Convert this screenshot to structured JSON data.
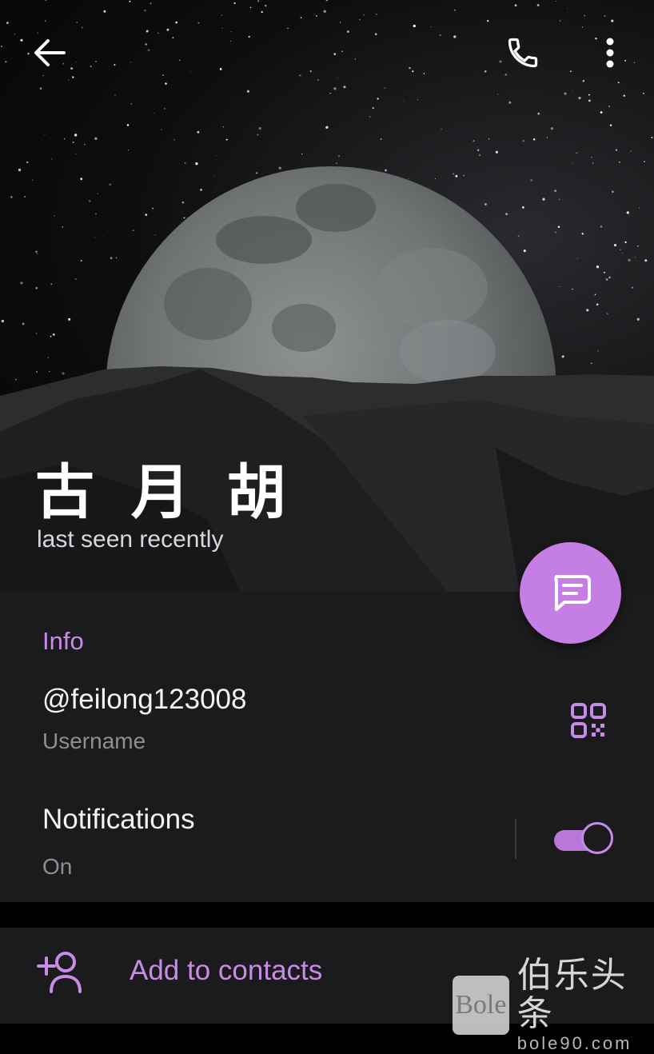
{
  "header": {
    "name": "古 月 胡",
    "status": "last seen recently",
    "icons": {
      "back": "arrow-left-icon",
      "call": "phone-icon",
      "more": "more-vertical-icon"
    }
  },
  "fab": {
    "icon": "message-icon"
  },
  "info": {
    "section_title": "Info",
    "username_value": "@feilong123008",
    "username_label": "Username",
    "qr_icon": "qr-code-icon",
    "notifications_title": "Notifications",
    "notifications_state": "On",
    "notifications_enabled": true
  },
  "contacts": {
    "label": "Add to contacts",
    "icon": "add-user-icon"
  },
  "watermark": {
    "logo": "Bole",
    "text": "伯乐头条",
    "url": "bole90.com"
  },
  "colors": {
    "accent": "#c78be8",
    "fab": "#c57ee3",
    "panel": "#1b1a1c",
    "muted_text": "#8f8e93"
  }
}
